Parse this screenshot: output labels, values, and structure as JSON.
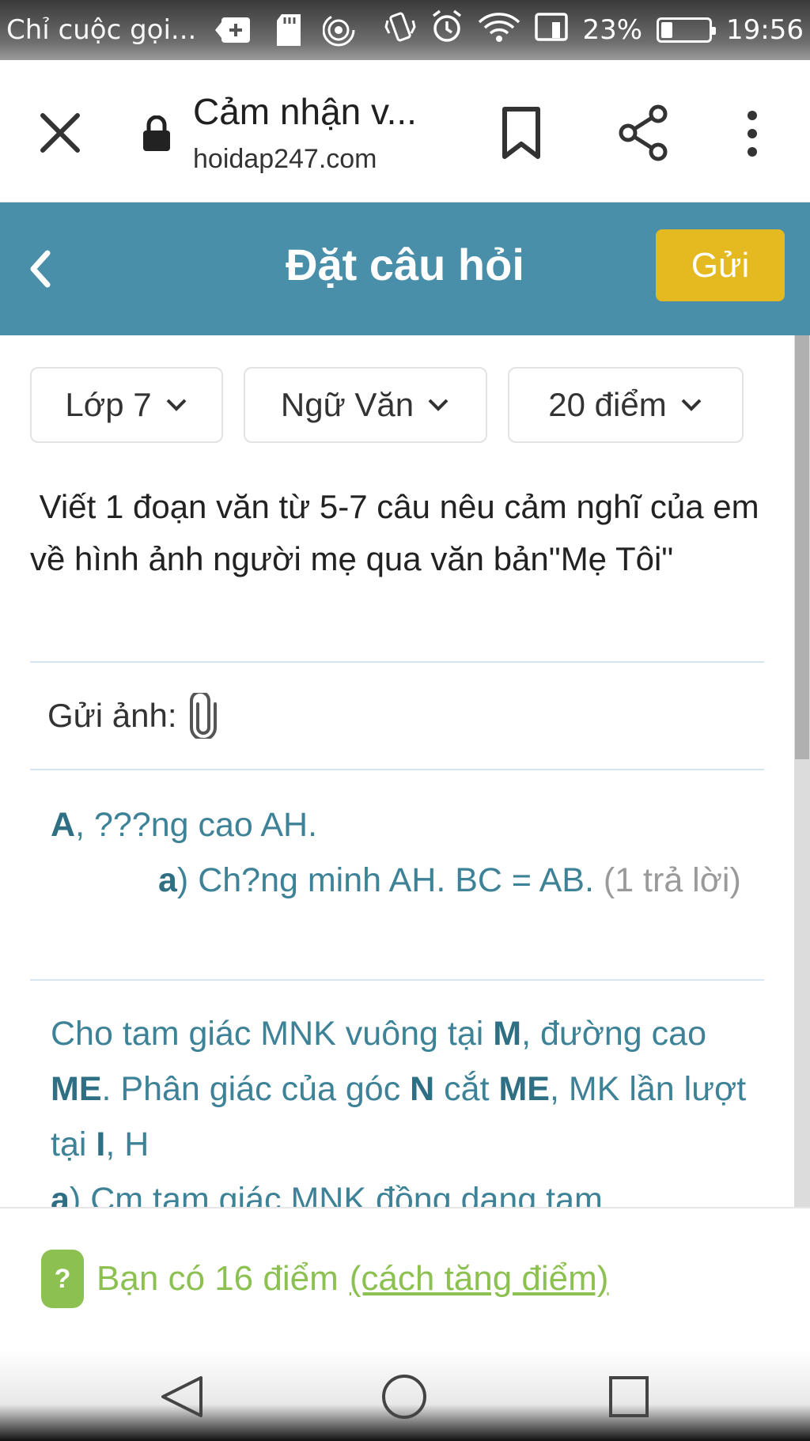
{
  "status_bar": {
    "notification": "Chỉ cuộc gọi...",
    "battery": "23%",
    "time": "19:56",
    "icons": [
      "plus-box-icon",
      "sd-card-icon",
      "hotspot-icon",
      "vibrate-icon",
      "alarm-icon",
      "wifi-icon",
      "sim-icon",
      "battery-icon"
    ]
  },
  "browser": {
    "tab_title": "Cảm nhận v...",
    "url": "hoidap247.com",
    "icons": [
      "close-icon",
      "lock-icon",
      "bookmark-icon",
      "share-icon",
      "more-vert-icon"
    ]
  },
  "header": {
    "title": "Đặt câu hỏi",
    "send_label": "Gửi",
    "accent": "#4a8faa",
    "send_color": "#e5b920"
  },
  "filters": {
    "grade": "Lớp 7",
    "subject": "Ngữ Văn",
    "points": "20 điểm"
  },
  "question": {
    "text": " Viết 1 đoạn văn từ 5-7 câu nêu cảm nghĩ của em về hình ảnh người mẹ qua văn bản\"Mẹ Tôi\""
  },
  "attachment": {
    "label": "Gửi ảnh:"
  },
  "suggestions": [
    {
      "p1_b": "A",
      "p1_t": ", ???ng cao AH.",
      "p2_b": "a",
      "p2_t": ") Ch?ng minh AH. BC = AB. ",
      "count": "(1 trả lời)"
    },
    {
      "s1": "Cho tam giác MNK vuông tại ",
      "b1": "M",
      "s2": ", đường cao ",
      "b2": "ME",
      "s3": ". Phân giác của góc ",
      "b3": "N",
      "s4": " cắt ",
      "b4": "ME",
      "s5": ", MK lần lượt tại ",
      "b5": "I",
      "s6": ", H",
      "b6": "a",
      "s7": ") Cm tam giác MNK đồng dạng tam"
    }
  ],
  "points_bar": {
    "text": "Bạn có 16 điểm",
    "link": "(cách tăng điểm)",
    "badge": "?",
    "color": "#8cc152"
  }
}
